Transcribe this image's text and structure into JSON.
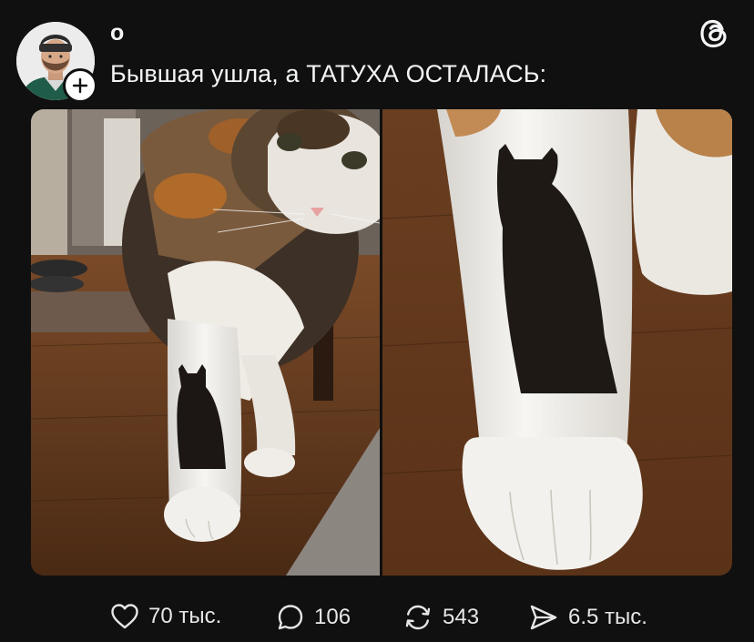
{
  "post": {
    "username": "о",
    "caption": "Бывшая ушла, а ТАТУХА ОСТАЛАСЬ:",
    "avatar_icon": "user-avatar",
    "follow_icon": "plus-icon",
    "logo_icon": "threads-logo-icon"
  },
  "images": [
    {
      "name": "cat-leg-photo",
      "subject": "calico cat standing on wooden floor"
    },
    {
      "name": "cat-leg-closeup-photo",
      "subject": "close-up of cat leg with cat-shaped spot"
    }
  ],
  "actions": {
    "likes": {
      "icon": "heart-icon",
      "count": "70 тыс."
    },
    "replies": {
      "icon": "comment-icon",
      "count": "106"
    },
    "reposts": {
      "icon": "repost-icon",
      "count": "543"
    },
    "shares": {
      "icon": "send-icon",
      "count": "6.5 тыс."
    }
  },
  "colors": {
    "background": "#101010",
    "text": "#f3f5f7",
    "muted": "#e6e6e6"
  }
}
